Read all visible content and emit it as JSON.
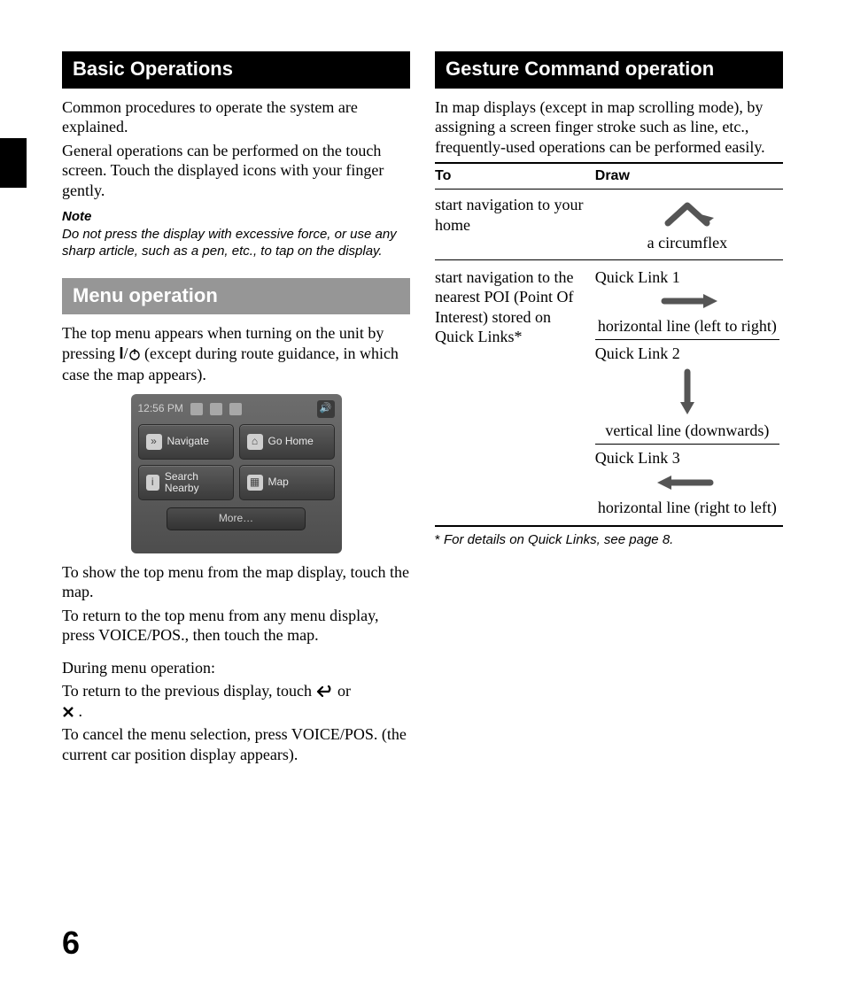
{
  "page_number": "6",
  "left": {
    "heading1": "Basic Operations",
    "intro1": "Common procedures to operate the system are explained.",
    "intro2": "General operations can be performed on the touch screen. Touch the displayed icons with your finger gently.",
    "note_label": "Note",
    "note_body": "Do not press the display with excessive force, or use any sharp article, such as a pen, etc., to tap on the display.",
    "heading2": "Menu operation",
    "menu_p1a": "The top menu appears when turning on the unit by pressing ",
    "menu_p1_key": "I",
    "menu_p1b": "/",
    "menu_p1c": " (except during route guidance, in which case the map appears).",
    "screenshot": {
      "time": "12:56 PM",
      "btn_navigate": "Navigate",
      "btn_gohome": "Go Home",
      "btn_search": "Search Nearby",
      "btn_map": "Map",
      "more": "More…"
    },
    "menu_p2": "To show the top menu from the map display, touch the map.",
    "menu_p3": "To return to the top menu from any menu display, press VOICE/POS., then touch the map.",
    "menu_p4": "During menu operation:",
    "menu_p5a": "To return to the previous display, touch ",
    "menu_p5b": " or ",
    "menu_p5c": " .",
    "menu_p6": "To cancel the menu selection, press VOICE/POS. (the current car position display appears)."
  },
  "right": {
    "heading": "Gesture Command operation",
    "intro": "In map displays (except in map scrolling mode), by assigning a screen finger stroke such as line, etc., frequently-used operations can be performed easily.",
    "thead_to": "To",
    "thead_draw": "Draw",
    "row1_to": "start navigation to your home",
    "row1_label": "a circumflex",
    "row2_to": "start navigation to the nearest POI (Point Of Interest) stored on Quick Links*",
    "ql1_title": "Quick Link 1",
    "ql1_label": "horizontal line (left to right)",
    "ql2_title": "Quick Link 2",
    "ql2_label": "vertical line (downwards)",
    "ql3_title": "Quick Link 3",
    "ql3_label": "horizontal line (right to left)",
    "footnote": "For details on Quick Links, see page 8."
  }
}
